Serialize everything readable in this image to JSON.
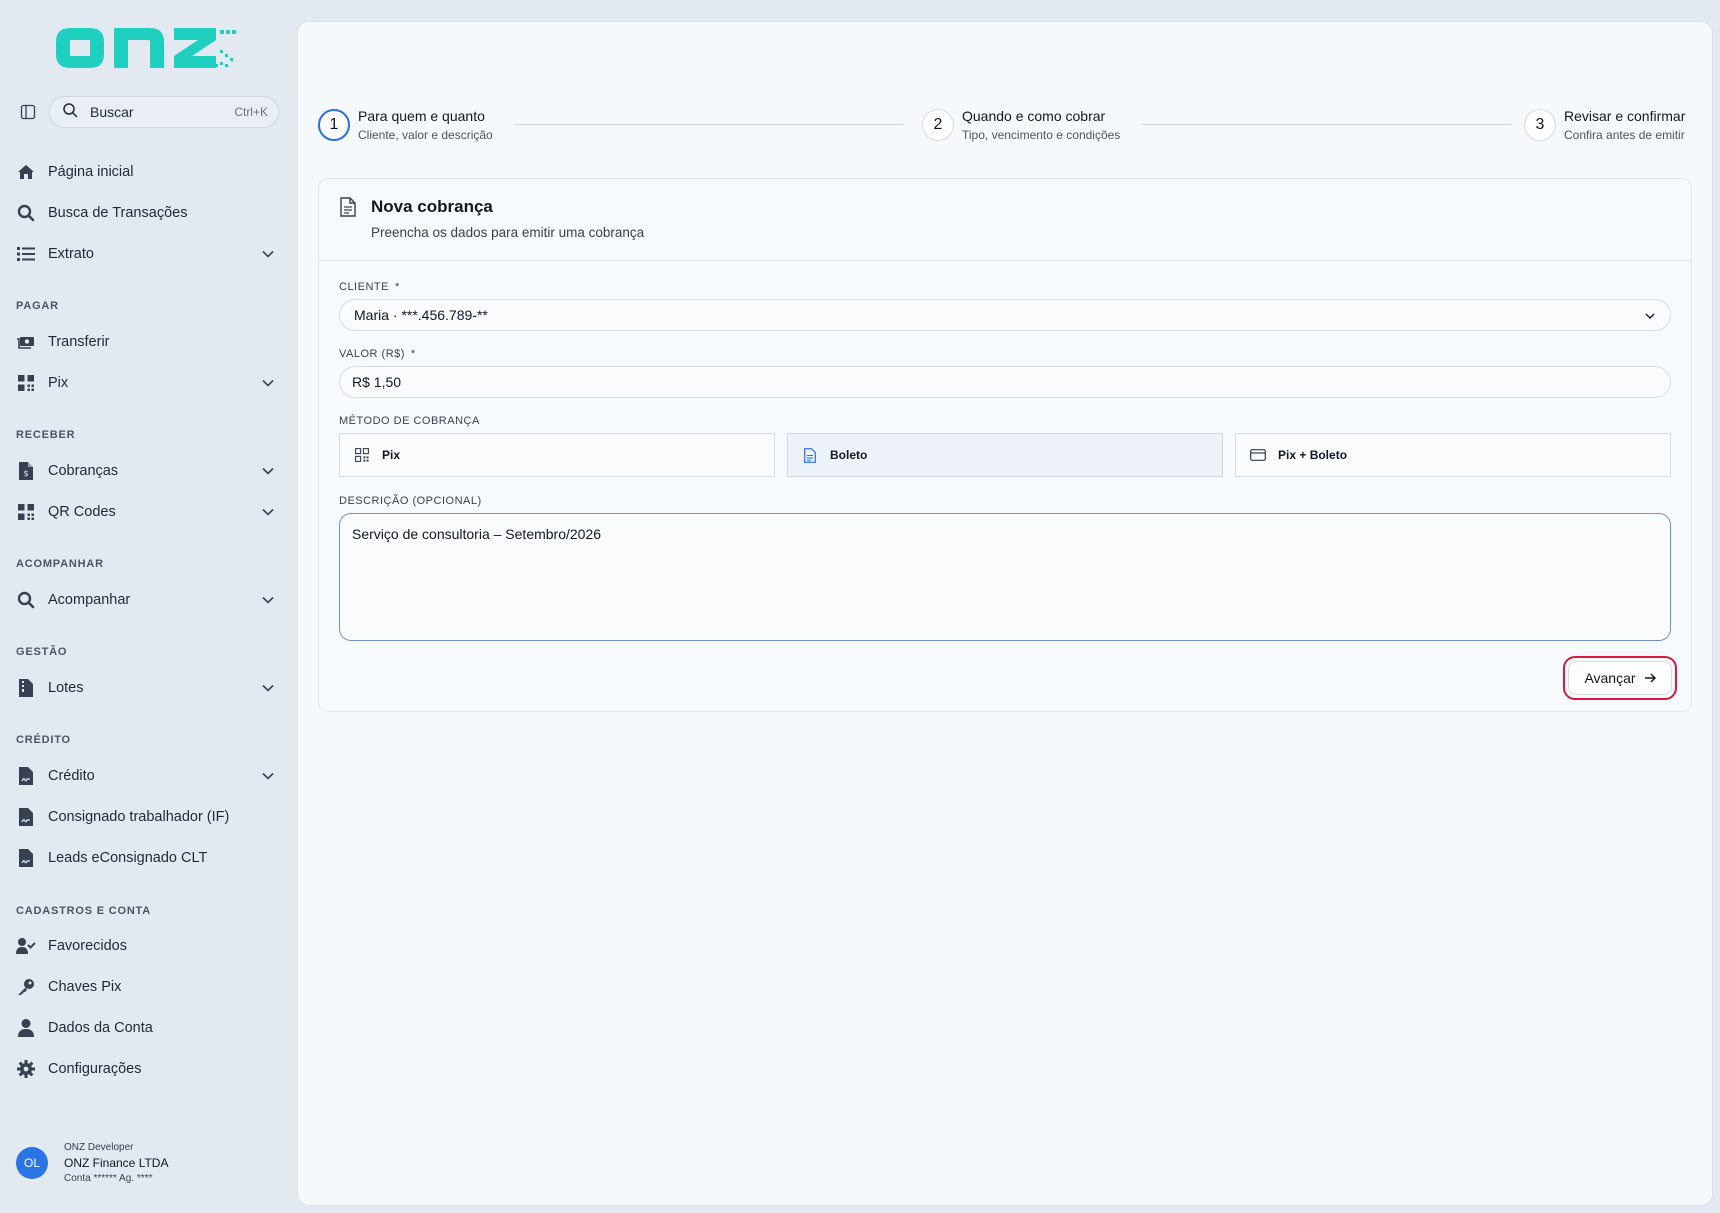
{
  "brand": {
    "logo_text": "onz",
    "accent": "#1fcfc0"
  },
  "search": {
    "label": "Buscar",
    "shortcut": "Ctrl+K"
  },
  "nav": {
    "top": [
      {
        "label": "Página inicial",
        "icon": "home-icon"
      },
      {
        "label": "Busca de Transações",
        "icon": "search-icon"
      },
      {
        "label": "Extrato",
        "icon": "list-icon"
      }
    ],
    "sections": {
      "pagar": "PAGAR",
      "receber": "RECEBER",
      "acompanhar": "ACOMPANHAR",
      "gestao": "GESTÃO",
      "credito": "CRÉDITO",
      "cadastros": "CADASTROS E CONTA"
    },
    "pagar": [
      {
        "label": "Transferir",
        "icon": "money-transfer-icon"
      },
      {
        "label": "Pix",
        "icon": "qr-grid-icon"
      }
    ],
    "receber": [
      {
        "label": "Cobranças",
        "icon": "invoice-icon"
      },
      {
        "label": "QR Codes",
        "icon": "qr-grid-icon"
      }
    ],
    "acompanhar": [
      {
        "label": "Acompanhar",
        "icon": "search-icon"
      }
    ],
    "gestao": [
      {
        "label": "Lotes",
        "icon": "file-zip-icon"
      }
    ],
    "credito": [
      {
        "label": "Crédito",
        "icon": "file-signature-icon"
      },
      {
        "label": "Consignado trabalhador (IF)",
        "icon": "file-signature-icon"
      },
      {
        "label": "Leads eConsignado CLT",
        "icon": "file-signature-icon"
      }
    ],
    "cadastros": [
      {
        "label": "Favorecidos",
        "icon": "user-check-icon"
      },
      {
        "label": "Chaves Pix",
        "icon": "key-icon"
      },
      {
        "label": "Dados da Conta",
        "icon": "user-icon"
      },
      {
        "label": "Configurações",
        "icon": "gear-icon"
      }
    ]
  },
  "user": {
    "initials": "OL",
    "role": "ONZ Developer",
    "company": "ONZ Finance LTDA",
    "account": "Conta ****** Ag. ****"
  },
  "stepper": {
    "steps": [
      {
        "number": "1",
        "title": "Para quem e quanto",
        "subtitle": "Cliente, valor e descrição",
        "active": true
      },
      {
        "number": "2",
        "title": "Quando e como cobrar",
        "subtitle": "Tipo, vencimento e condições",
        "active": false
      },
      {
        "number": "3",
        "title": "Revisar e confirmar",
        "subtitle": "Confira antes de emitir",
        "active": false
      }
    ]
  },
  "card": {
    "title": "Nova cobrança",
    "subtitle": "Preencha os dados para emitir uma cobrança"
  },
  "form": {
    "cliente_label": "CLIENTE",
    "required_mark": "*",
    "cliente_value": "Maria · ***.456.789-**",
    "valor_label": "VALOR (R$)",
    "valor_value": "R$ 1,50",
    "metodo_label": "MÉTODO DE COBRANÇA",
    "metodos": [
      {
        "label": "Pix",
        "icon": "qr-grid-icon",
        "selected": false
      },
      {
        "label": "Boleto",
        "icon": "document-icon",
        "selected": true
      },
      {
        "label": "Pix + Boleto",
        "icon": "card-icon",
        "selected": false
      }
    ],
    "descricao_label": "DESCRIÇÃO (OPCIONAL)",
    "descricao_value": "Serviço de consultoria – Setembro/2026",
    "advance_label": "Avançar"
  }
}
